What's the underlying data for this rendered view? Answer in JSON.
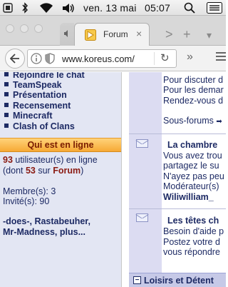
{
  "menubar": {
    "date": "ven. 13 mai",
    "time": "05:07",
    "icons": [
      "bluetooth-icon",
      "wifi-icon",
      "volume-icon",
      "menu-extra-icon"
    ]
  },
  "browser": {
    "tab_title": "Forum",
    "tab_close": "×",
    "url": "www.koreus.com/",
    "reload": "↻",
    "overflow": "»",
    "tab_back": "<",
    "tab_forward": ">",
    "tab_new": "+"
  },
  "sidebar": {
    "links": [
      "Rejoindre le chat",
      "TeamSpeak",
      "Présentation",
      "Recensement",
      "Minecraft",
      "Clash of Clans"
    ],
    "online_header": "Qui est en ligne",
    "online_count": "93",
    "online_text": " utilisateur(s) en ligne",
    "online_sub_pre": "(dont ",
    "online_sub_count": "53",
    "online_sub_mid": " sur ",
    "online_sub_forum": "Forum",
    "online_sub_post": ")",
    "members": "Membre(s): 3",
    "guests": "Invité(s): 90",
    "users_line1": "-does-, Rastabeuher,",
    "users_line2": "Mr-Madness, plus..."
  },
  "main": {
    "block1_lines": [
      "Pour discuter d",
      "Pour les demar",
      "Rendez-vous d"
    ],
    "subforums": "Sous-forums",
    "topic2_title": "La chambre",
    "topic2_lines": [
      "Vous avez trou",
      "partagez le su",
      "N'ayez pas peu",
      "Modérateur(s)"
    ],
    "topic2_mod": "Wiliwilliam_",
    "topic3_title": "Les têtes ch",
    "topic3_lines": [
      "Besoin d'aide p",
      "Postez votre d",
      "vous répondre"
    ],
    "category_title": "Loisirs et Détent",
    "category_toggle": "−"
  }
}
